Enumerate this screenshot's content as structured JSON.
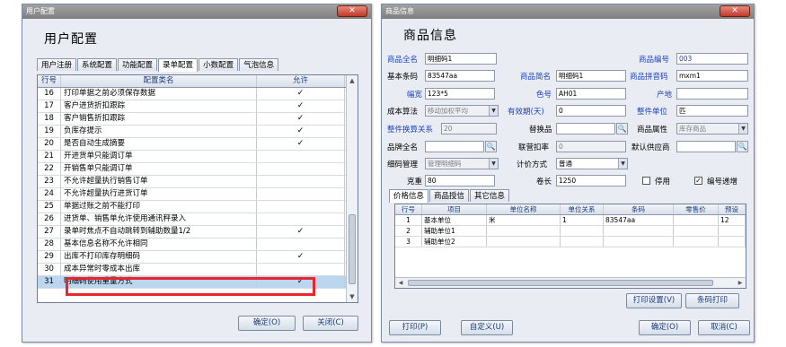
{
  "left": {
    "title": "用户配置",
    "heading": "用户配置",
    "close_label": "✕",
    "tabs": [
      "用户注册",
      "系统配置",
      "功能配置",
      "录单配置",
      "小数配置",
      "气泡信息"
    ],
    "columns": {
      "no": "行号",
      "name": "配置类名",
      "allow": "允许"
    },
    "rows": [
      {
        "no": "16",
        "name": "打印单据之前必须保存数据",
        "allow": "✓"
      },
      {
        "no": "17",
        "name": "客户进货折扣跟踪",
        "allow": "✓"
      },
      {
        "no": "18",
        "name": "客户销售折扣跟踪",
        "allow": "✓"
      },
      {
        "no": "19",
        "name": "负库存提示",
        "allow": "✓"
      },
      {
        "no": "20",
        "name": "是否自动生成摘要",
        "allow": "✓"
      },
      {
        "no": "21",
        "name": "开进货单只能调订单",
        "allow": ""
      },
      {
        "no": "22",
        "name": "开销售单只能调订单",
        "allow": ""
      },
      {
        "no": "23",
        "name": "不允许超量执行销售订单",
        "allow": ""
      },
      {
        "no": "24",
        "name": "不允许超量执行进货订单",
        "allow": ""
      },
      {
        "no": "25",
        "name": "单据过账之前不能打印",
        "allow": ""
      },
      {
        "no": "26",
        "name": "进货单、销售单允许使用通讯秤录入",
        "allow": ""
      },
      {
        "no": "27",
        "name": "录单时焦点不自动跳转到辅助数量1/2",
        "allow": "✓"
      },
      {
        "no": "28",
        "name": "基本信息名称不允许相同",
        "allow": ""
      },
      {
        "no": "29",
        "name": "出库不打印库存明细码",
        "allow": "✓"
      },
      {
        "no": "30",
        "name": "成本异常时零成本出库",
        "allow": ""
      },
      {
        "no": "31",
        "name": "明细码使用重量方式",
        "allow": "✓"
      }
    ],
    "buttons": {
      "ok": "确定(O)",
      "close": "关闭(C)"
    }
  },
  "right": {
    "title": "商品信息",
    "heading": "商品信息",
    "close_label": "✕",
    "form": {
      "full_name_label": "商品全名",
      "full_name": "明细码1",
      "code_label": "商品编号",
      "code": "003",
      "barcode_label": "基本条码",
      "barcode": "83547aa",
      "short_name_label": "商品简名",
      "short_name": "明细码1",
      "pinyin_label": "商品拼音码",
      "pinyin": "mxm1",
      "width_label": "幅宽",
      "width": "123*5",
      "color_label": "色号",
      "color": "AH01",
      "origin_label": "产地",
      "origin": "",
      "cost_label": "成本算法",
      "cost": "移动加权平均",
      "validity_label": "有效期(天)",
      "validity": "0",
      "unit_label": "整件单位",
      "unit": "匹",
      "conv_label": "整件换算关系",
      "conv": "20",
      "substitute_label": "替换品",
      "substitute": "",
      "attr_label": "商品属性",
      "attr": "库存商品",
      "brand_label": "品牌全名",
      "brand": "",
      "discount_label": "联营扣率",
      "discount": "0",
      "supplier_label": "默认供应商",
      "supplier": "",
      "detail_label": "细码管理",
      "detail": "管理明细码",
      "pricing_label": "计价方式",
      "pricing": "普通",
      "gross_label": "克重",
      "gross": "80",
      "roll_label": "卷长",
      "roll": "1250",
      "disable_label": "停用",
      "increment_label": "编号递增"
    },
    "tabs": [
      "价格信息",
      "商品授信",
      "其它信息"
    ],
    "grid": {
      "columns": [
        "行号",
        "项目",
        "单位名称",
        "单位关系",
        "条码",
        "零售价",
        "预设"
      ],
      "rows": [
        [
          "1",
          "基本单位",
          "米",
          "1",
          "83547aa",
          "",
          "12"
        ],
        [
          "2",
          "辅助单位1",
          "",
          "",
          "",
          "",
          ""
        ],
        [
          "3",
          "辅助单位2",
          "",
          "",
          "",
          "",
          ""
        ]
      ]
    },
    "buttons": {
      "print_settings": "打印设置(V)",
      "barcode_print": "条码打印",
      "print": "打印(P)",
      "custom": "自定义(U)",
      "ok": "确定(O)",
      "cancel": "取消(C)"
    }
  }
}
